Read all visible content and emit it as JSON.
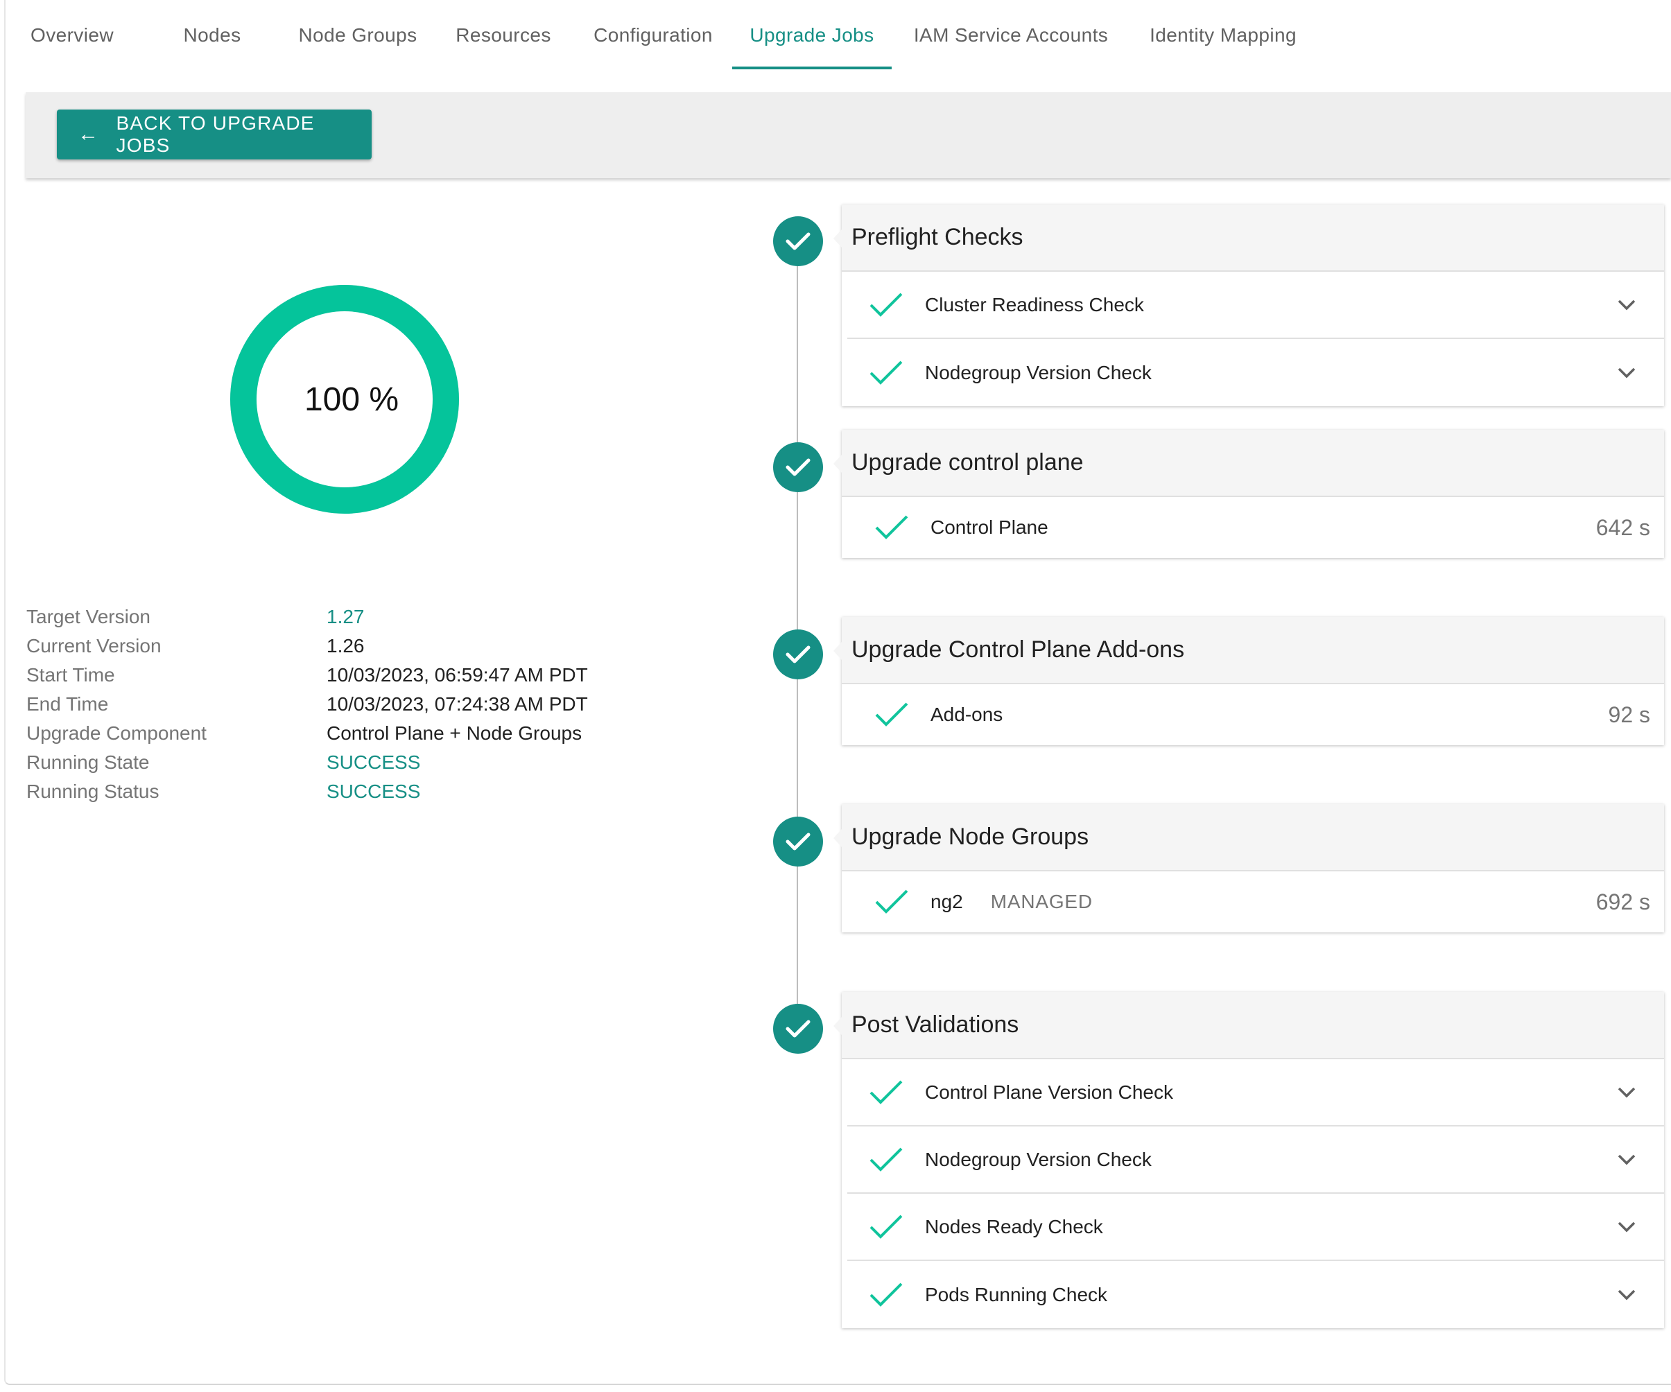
{
  "tabs": [
    {
      "label": "Overview",
      "active": false
    },
    {
      "label": "Nodes",
      "active": false
    },
    {
      "label": "Node Groups",
      "active": false
    },
    {
      "label": "Resources",
      "active": false
    },
    {
      "label": "Configuration",
      "active": false
    },
    {
      "label": "Upgrade Jobs",
      "active": true
    },
    {
      "label": "IAM Service Accounts",
      "active": false
    },
    {
      "label": "Identity Mapping",
      "active": false
    }
  ],
  "toolbar": {
    "back_label": "BACK TO UPGRADE JOBS",
    "back_icon": "arrow-left-icon"
  },
  "progress": {
    "value": 100,
    "label": "100 %"
  },
  "details": [
    {
      "label": "Target Version",
      "value": "1.27",
      "color": "#168f85"
    },
    {
      "label": "Current Version",
      "value": "1.26",
      "color": "#212121"
    },
    {
      "label": "Start Time",
      "value": "10/03/2023, 06:59:47 AM PDT",
      "color": "#212121"
    },
    {
      "label": "End Time",
      "value": "10/03/2023, 07:24:38 AM PDT",
      "color": "#212121"
    },
    {
      "label": "Upgrade Component",
      "value": "Control Plane + Node Groups",
      "color": "#212121"
    },
    {
      "label": "Running State",
      "value": "SUCCESS",
      "color": "#168f85"
    },
    {
      "label": "Running Status",
      "value": "SUCCESS",
      "color": "#168f85"
    }
  ],
  "stages": [
    {
      "title": "Preflight Checks",
      "items": [
        {
          "name": "Cluster Readiness Check",
          "expandable": true
        },
        {
          "name": "Nodegroup Version Check",
          "expandable": true
        }
      ]
    },
    {
      "title": "Upgrade control plane",
      "items": [
        {
          "name": "Control Plane",
          "duration": "642 s"
        }
      ]
    },
    {
      "title": "Upgrade Control Plane Add-ons",
      "items": [
        {
          "name": "Add-ons",
          "duration": "92 s"
        }
      ]
    },
    {
      "title": "Upgrade Node Groups",
      "items": [
        {
          "name": "ng2",
          "tag": "MANAGED",
          "duration": "692 s"
        }
      ]
    },
    {
      "title": "Post Validations",
      "items": [
        {
          "name": "Control Plane Version Check",
          "expandable": true
        },
        {
          "name": "Nodegroup Version Check",
          "expandable": true
        },
        {
          "name": "Nodes Ready Check",
          "expandable": true
        },
        {
          "name": "Pods Running Check",
          "expandable": true
        }
      ]
    }
  ],
  "colors": {
    "accent": "#168f85",
    "success_check": "#10c49c",
    "ring": "#05c49b"
  },
  "icons": {
    "stage_status": "check-circle-icon",
    "item_status": "check-icon",
    "expand": "chevron-down-icon"
  }
}
